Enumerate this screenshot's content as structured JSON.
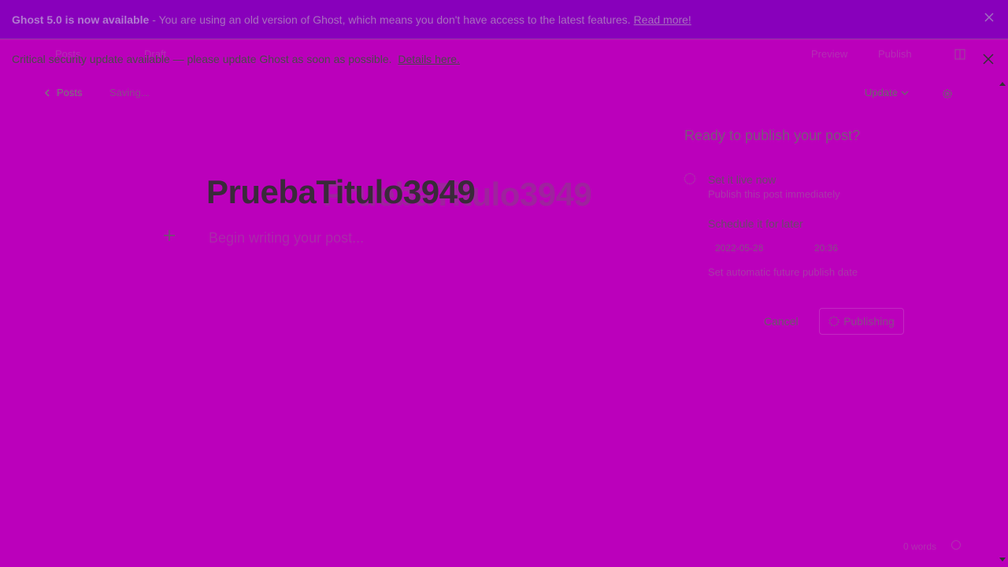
{
  "banner": {
    "strong": "Ghost 5.0 is now available",
    "text": "- You are using an old version of Ghost, which means you don't have access to the latest features.",
    "link": "Read more!"
  },
  "security": {
    "text": "Critical security update available — please update Ghost as soon as possible.",
    "link": "Details here."
  },
  "ghost_header": {
    "back": "Posts",
    "status": "Draft",
    "preview": "Preview",
    "publish": "Publish"
  },
  "editor": {
    "back_label": "Posts",
    "status": "Saving...",
    "update_label": "Update",
    "title": "PruebaTitulo3949",
    "body_placeholder": "Begin writing your post..."
  },
  "publish_panel": {
    "heading": "Ready to publish your post?",
    "option_now_label": "Set it live now",
    "option_now_sub": "Publish this post immediately",
    "option_later_label": "Schedule it for later",
    "date": "2022-05-28",
    "time": "20:36",
    "later_sub": "Set automatic future publish date",
    "cancel": "Cancel",
    "publishing": "Publishing"
  },
  "footer": {
    "word_count": "0 words"
  },
  "colors": {
    "page_bg": "#bb00bb",
    "banner_bg": "#8800bb"
  }
}
